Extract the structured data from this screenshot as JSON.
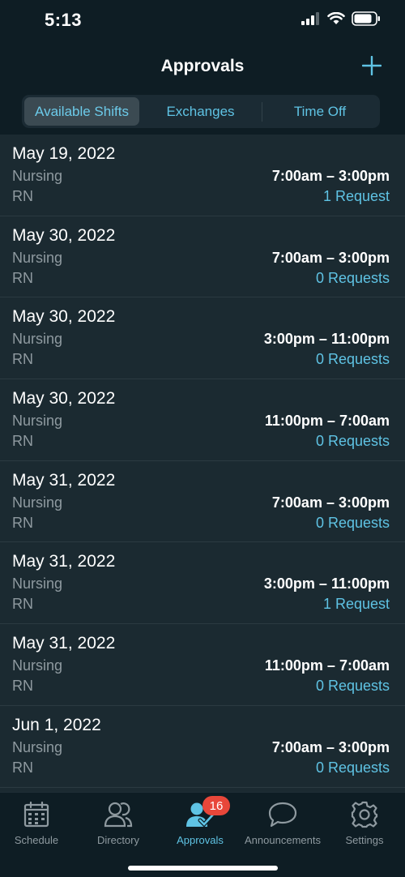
{
  "status_bar": {
    "time": "5:13"
  },
  "header": {
    "title": "Approvals",
    "add_icon": "plus-icon"
  },
  "segments": [
    {
      "label": "Available Shifts",
      "active": true
    },
    {
      "label": "Exchanges",
      "active": false
    },
    {
      "label": "Time Off",
      "active": false
    }
  ],
  "shifts": [
    {
      "date": "May 19, 2022",
      "department": "Nursing",
      "role": "RN",
      "time": "7:00am – 3:00pm",
      "requests": "1 Request"
    },
    {
      "date": "May 30, 2022",
      "department": "Nursing",
      "role": "RN",
      "time": "7:00am – 3:00pm",
      "requests": "0 Requests"
    },
    {
      "date": "May 30, 2022",
      "department": "Nursing",
      "role": "RN",
      "time": "3:00pm – 11:00pm",
      "requests": "0 Requests"
    },
    {
      "date": "May 30, 2022",
      "department": "Nursing",
      "role": "RN",
      "time": "11:00pm – 7:00am",
      "requests": "0 Requests"
    },
    {
      "date": "May 31, 2022",
      "department": "Nursing",
      "role": "RN",
      "time": "7:00am – 3:00pm",
      "requests": "0 Requests"
    },
    {
      "date": "May 31, 2022",
      "department": "Nursing",
      "role": "RN",
      "time": "3:00pm – 11:00pm",
      "requests": "1 Request"
    },
    {
      "date": "May 31, 2022",
      "department": "Nursing",
      "role": "RN",
      "time": "11:00pm – 7:00am",
      "requests": "0 Requests"
    },
    {
      "date": "Jun 1, 2022",
      "department": "Nursing",
      "role": "RN",
      "time": "7:00am – 3:00pm",
      "requests": "0 Requests"
    }
  ],
  "tabs": [
    {
      "label": "Schedule",
      "icon": "calendar-icon",
      "active": false
    },
    {
      "label": "Directory",
      "icon": "people-icon",
      "active": false
    },
    {
      "label": "Approvals",
      "icon": "approvals-person-check-icon",
      "active": true,
      "badge": "16"
    },
    {
      "label": "Announcements",
      "icon": "chat-bubble-icon",
      "active": false
    },
    {
      "label": "Settings",
      "icon": "gear-icon",
      "active": false
    }
  ],
  "colors": {
    "accent": "#5fc3e4",
    "background": "#0e1d24",
    "list_background": "#1b2a31",
    "badge": "#e8473a"
  }
}
